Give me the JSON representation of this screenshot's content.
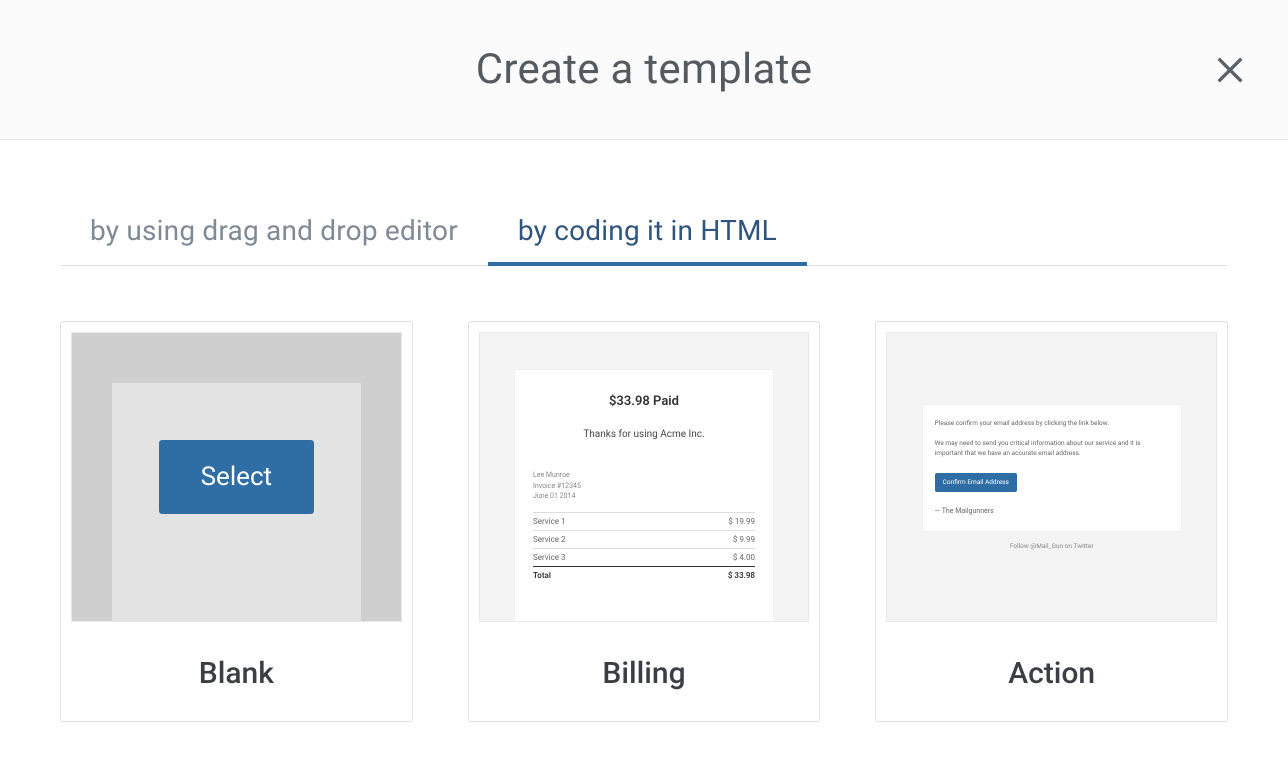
{
  "modal": {
    "title": "Create a template"
  },
  "tabs": [
    {
      "label": "by using drag and drop editor",
      "active": false
    },
    {
      "label": "by coding it in HTML",
      "active": true
    }
  ],
  "select_button_label": "Select",
  "cards": {
    "blank": {
      "title": "Blank"
    },
    "billing": {
      "title": "Billing",
      "preview": {
        "amount_line": "$33.98 Paid",
        "thanks_line": "Thanks for using Acme Inc.",
        "customer_name": "Lee Munroe",
        "invoice_no": "Invoice #12345",
        "date": "June 01 2014",
        "rows": [
          {
            "label": "Service 1",
            "value": "$ 19.99"
          },
          {
            "label": "Service 2",
            "value": "$ 9.99"
          },
          {
            "label": "Service 3",
            "value": "$ 4.00"
          }
        ],
        "total_label": "Total",
        "total_value": "$ 33.98"
      }
    },
    "action": {
      "title": "Action",
      "preview": {
        "line1": "Please confirm your email address by clicking the link below.",
        "line2": "We may need to send you critical information about our service and it is important that we have an accurate email address.",
        "button_label": "Confirm Email Address",
        "signature": "— The Mailgunners",
        "footer": "Follow @Mail_Gun on Twitter"
      }
    }
  }
}
